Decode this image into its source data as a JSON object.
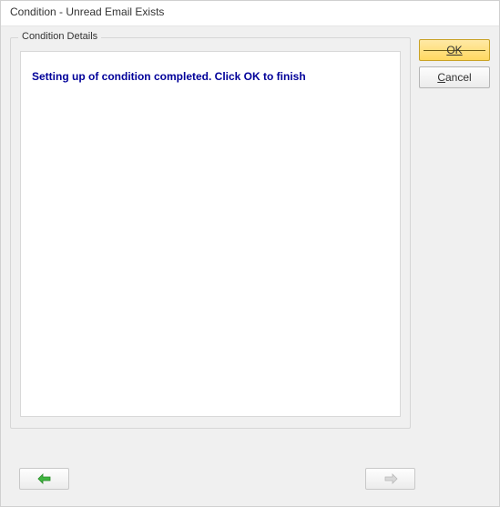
{
  "window": {
    "title": "Condition - Unread Email  Exists"
  },
  "panel": {
    "legend": "Condition Details",
    "message": "Setting up of condition completed. Click OK to finish"
  },
  "buttons": {
    "ok": "OK",
    "cancel_prefix": "C",
    "cancel_rest": "ancel"
  }
}
